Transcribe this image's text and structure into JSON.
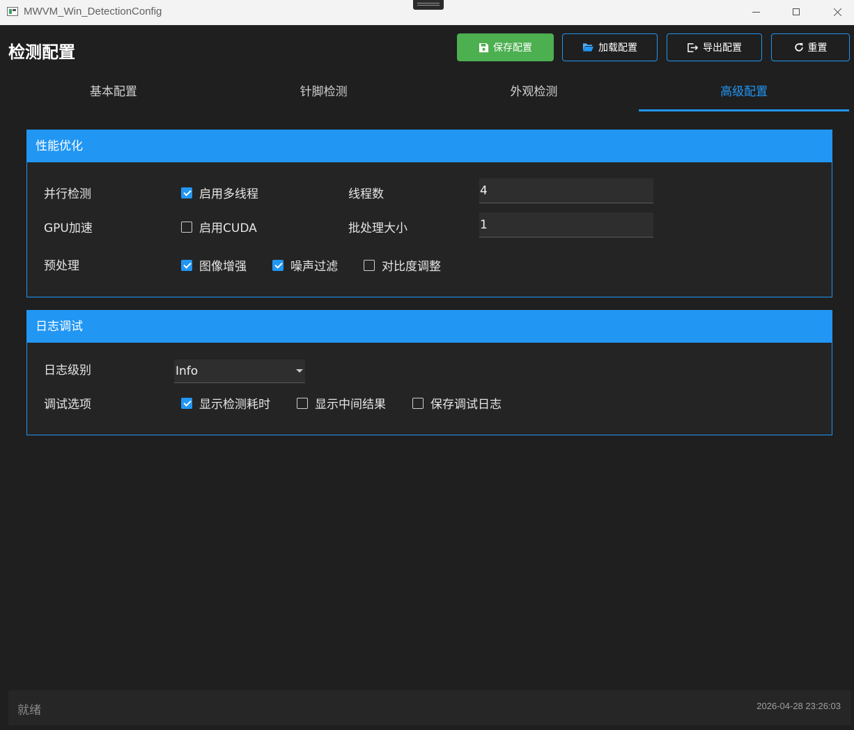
{
  "window": {
    "title": "MWVM_Win_DetectionConfig"
  },
  "header": {
    "title": "检测配置",
    "buttons": {
      "save": "保存配置",
      "load": "加载配置",
      "export": "导出配置",
      "reset": "重置"
    },
    "save_color": "#4caf50",
    "accent": "#2196f3"
  },
  "tabs": [
    {
      "label": "基本配置",
      "active": false
    },
    {
      "label": "针脚检测",
      "active": false
    },
    {
      "label": "外观检测",
      "active": false
    },
    {
      "label": "高级配置",
      "active": true
    }
  ],
  "performance": {
    "title": "性能优化",
    "parallel": {
      "label": "并行检测",
      "multithread": {
        "label": "启用多线程",
        "checked": true
      },
      "thread_count_label": "线程数",
      "thread_count": "4"
    },
    "gpu": {
      "label": "GPU加速",
      "cuda": {
        "label": "启用CUDA",
        "checked": false
      },
      "batch_size_label": "批处理大小",
      "batch_size": "1"
    },
    "preprocess": {
      "label": "预处理",
      "enhance": {
        "label": "图像增强",
        "checked": true
      },
      "denoise": {
        "label": "噪声过滤",
        "checked": true
      },
      "contrast": {
        "label": "对比度调整",
        "checked": false
      }
    }
  },
  "logging": {
    "title": "日志调试",
    "level": {
      "label": "日志级别",
      "value": "Info"
    },
    "debug": {
      "label": "调试选项",
      "show_time": {
        "label": "显示检测耗时",
        "checked": true
      },
      "show_intermediate": {
        "label": "显示中间结果",
        "checked": false
      },
      "save_log": {
        "label": "保存调试日志",
        "checked": false
      }
    }
  },
  "status": {
    "text": "就绪",
    "timestamp": "2026-04-28 23:26:03"
  }
}
